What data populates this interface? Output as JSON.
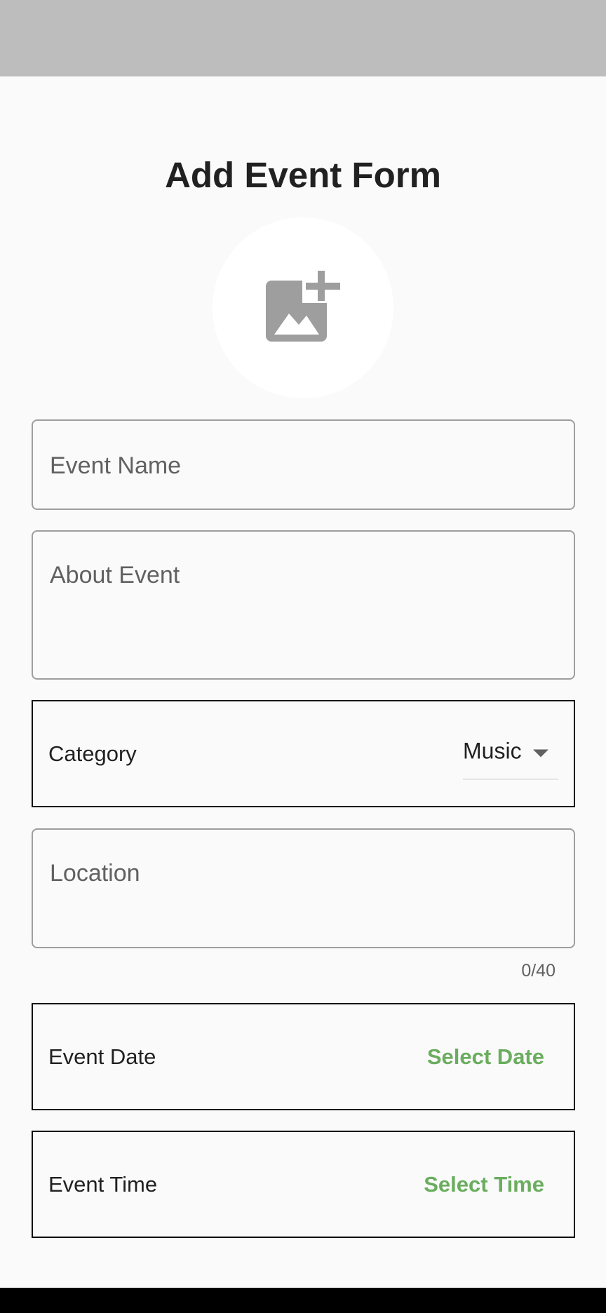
{
  "header": {
    "title": "Add Event Form"
  },
  "image_picker": {
    "icon": "add-photo-icon"
  },
  "form": {
    "event_name": {
      "placeholder": "Event Name",
      "value": ""
    },
    "about_event": {
      "placeholder": "About Event",
      "value": ""
    },
    "category": {
      "label": "Category",
      "selected": "Music"
    },
    "location": {
      "placeholder": "Location",
      "value": "",
      "counter": "0/40"
    },
    "event_date": {
      "label": "Event Date",
      "action": "Select Date"
    },
    "event_time": {
      "label": "Event Time",
      "action": "Select Time"
    }
  },
  "colors": {
    "accent": "#6aad5e",
    "status_bar": "#bdbdbd",
    "background": "#fafafa",
    "icon": "#9e9e9e"
  }
}
